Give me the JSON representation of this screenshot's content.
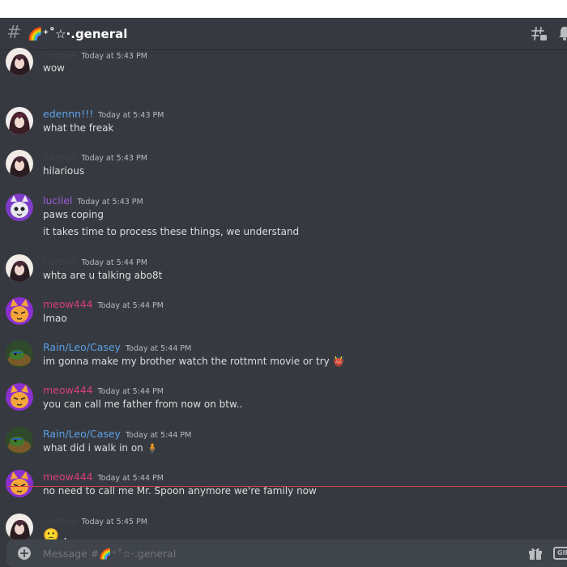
{
  "channel": {
    "hash_symbol": "#",
    "name": "🌈⁺˚☆·.general"
  },
  "colors": {
    "cereus": "#36393f",
    "edennn": "#5da2e8",
    "luciiel": "#a15ee0",
    "meow444": "#d83f7c",
    "rain": "#5aa0e6",
    "divider": "#d04145"
  },
  "messages": [
    {
      "author": "cereus",
      "author_color": "#3e424a",
      "timestamp": "Today at 5:43 PM",
      "lines": [
        "wow"
      ],
      "avatar": "cereus-avatar"
    },
    {
      "author": "edennn!!!",
      "author_color": "#5da2e8",
      "timestamp": "Today at 5:43 PM",
      "lines": [
        "what the freak"
      ],
      "avatar": "edennn-avatar"
    },
    {
      "author": "cereus",
      "author_color": "#3e424a",
      "timestamp": "Today at 5:43 PM",
      "lines": [
        "hilarious"
      ],
      "avatar": "cereus-avatar"
    },
    {
      "author": "luciiel",
      "author_color": "#a15ee0",
      "timestamp": "Today at 5:43 PM",
      "lines": [
        "paws coping",
        "it takes time to process these things, we understand"
      ],
      "avatar": "luciiel-avatar"
    },
    {
      "author": "cereus",
      "author_color": "#3e424a",
      "timestamp": "Today at 5:44 PM",
      "lines": [
        "whta are u talking abo8t"
      ],
      "avatar": "cereus-avatar"
    },
    {
      "author": "meow444",
      "author_color": "#d83f7c",
      "timestamp": "Today at 5:44 PM",
      "lines": [
        "lmao"
      ],
      "avatar": "meow-avatar"
    },
    {
      "author": "Rain/Leo/Casey",
      "author_color": "#5aa0e6",
      "timestamp": "Today at 5:44 PM",
      "lines": [
        "im gonna make my brother watch the rottmnt movie or try 👹"
      ],
      "avatar": "rain-avatar"
    },
    {
      "author": "meow444",
      "author_color": "#d83f7c",
      "timestamp": "Today at 5:44 PM",
      "lines": [
        "you can call me father from now on btw.."
      ],
      "avatar": "meow-avatar"
    },
    {
      "author": "Rain/Leo/Casey",
      "author_color": "#5aa0e6",
      "timestamp": "Today at 5:44 PM",
      "lines": [
        "what did i walk in on 🧍"
      ],
      "avatar": "rain-avatar"
    },
    {
      "author": "meow444",
      "author_color": "#d83f7c",
      "timestamp": "Today at 5:44 PM",
      "lines": [
        "no need to call me Mr. Spoon anymore we're family now"
      ],
      "avatar": "meow-avatar"
    },
    {
      "author": "cereus",
      "author_color": "#3e424a",
      "timestamp": "Today at 5:45 PM",
      "lines": [
        "🙁 ."
      ],
      "avatar": "cereus-avatar"
    }
  ],
  "composer": {
    "placeholder": "Message #🌈⁺˚☆·.general",
    "gif_label": "GIF"
  }
}
